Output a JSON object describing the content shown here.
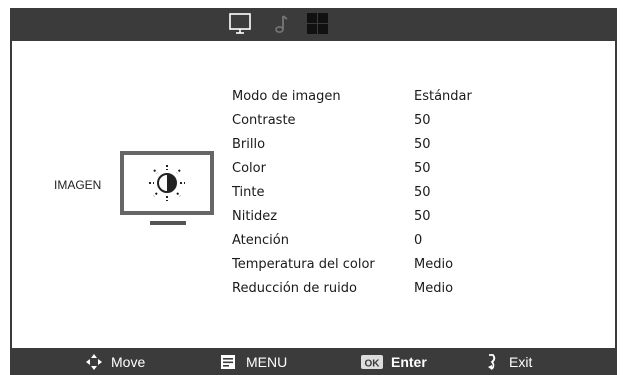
{
  "tabs": [
    {
      "icon": "monitor-icon",
      "selected": true
    },
    {
      "icon": "music-note-icon",
      "selected": false
    },
    {
      "icon": "grid-icon",
      "selected": false
    }
  ],
  "category": {
    "label": "IMAGEN",
    "icon": "monitor-brightness-icon"
  },
  "menu": {
    "items": [
      {
        "label": "Modo de imagen",
        "value": "Estándar"
      },
      {
        "label": "Contraste",
        "value": "50"
      },
      {
        "label": "Brillo",
        "value": "50"
      },
      {
        "label": "Color",
        "value": "50"
      },
      {
        "label": "Tinte",
        "value": "50"
      },
      {
        "label": "Nitidez",
        "value": "50"
      },
      {
        "label": "Atención",
        "value": "0"
      },
      {
        "label": "Temperatura del color",
        "value": "Medio"
      },
      {
        "label": "Reducción de ruido",
        "value": "Medio"
      }
    ]
  },
  "footer": {
    "move_label": "Move",
    "menu_label": "MENU",
    "ok_badge": "OK",
    "enter_label": "Enter",
    "exit_label": "Exit"
  },
  "colors": {
    "bar": "#3b3b3b",
    "icon_gray": "#666666",
    "text": "#1a1a1a"
  }
}
